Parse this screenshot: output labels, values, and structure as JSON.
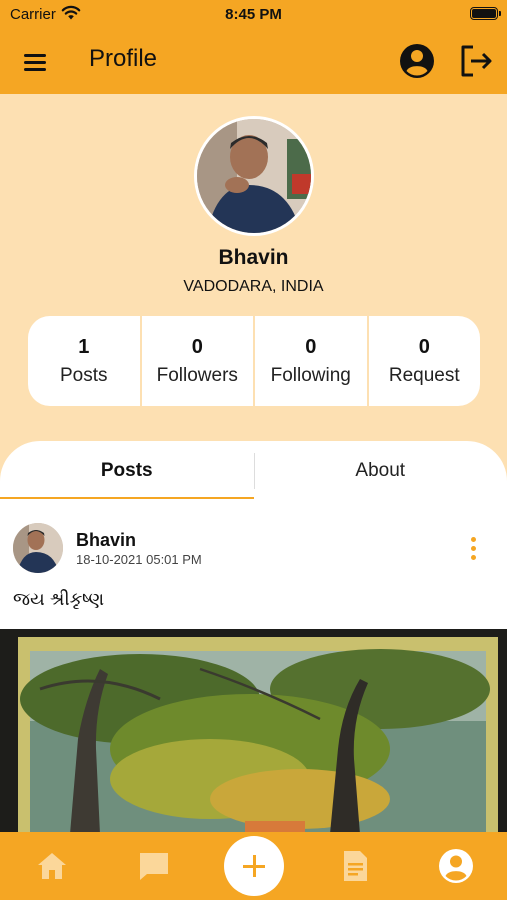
{
  "status_bar": {
    "carrier": "Carrier",
    "time": "8:45 PM"
  },
  "app_bar": {
    "title": "Profile",
    "icons": [
      "menu-icon",
      "account-circle-icon",
      "logout-icon"
    ]
  },
  "profile": {
    "name": "Bhavin",
    "location": "VADODARA, INDIA"
  },
  "stats": [
    {
      "value": "1",
      "label": "Posts"
    },
    {
      "value": "0",
      "label": "Followers"
    },
    {
      "value": "0",
      "label": "Following"
    },
    {
      "value": "0",
      "label": "Request"
    }
  ],
  "tabs": [
    {
      "label": "Posts",
      "active": true
    },
    {
      "label": "About",
      "active": false
    }
  ],
  "post": {
    "author": "Bhavin",
    "timestamp": "18-10-2021 05:01 PM",
    "text": "જય શ્રીકૃષ્ણ"
  },
  "bottom_nav": {
    "items": [
      "home-icon",
      "chat-icon",
      "add-post-icon",
      "document-icon",
      "profile-icon"
    ],
    "active": "profile-icon"
  },
  "colors": {
    "accent": "#f5a623",
    "header_background": "#fde0b2",
    "text": "#111111"
  }
}
